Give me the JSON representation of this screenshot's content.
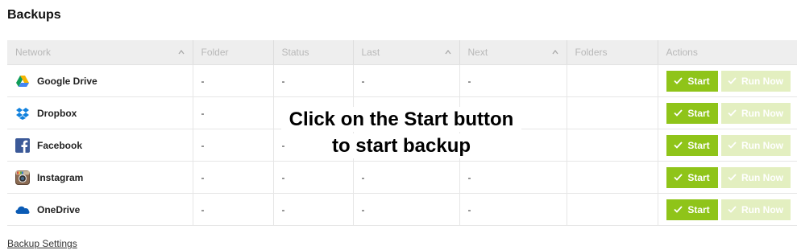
{
  "page": {
    "title": "Backups"
  },
  "table": {
    "headers": [
      "Network",
      "Folder",
      "Status",
      "Last",
      "Next",
      "Folders",
      "Actions"
    ],
    "rows": [
      {
        "network": "Google Drive",
        "icon": "google-drive-icon",
        "folder": "-",
        "status": "-",
        "last": "-",
        "next": "-",
        "folders": ""
      },
      {
        "network": "Dropbox",
        "icon": "dropbox-icon",
        "folder": "-",
        "status": "",
        "last": "",
        "next": "",
        "folders": ""
      },
      {
        "network": "Facebook",
        "icon": "facebook-icon",
        "folder": "-",
        "status": "-",
        "last": "",
        "next": "",
        "folders": ""
      },
      {
        "network": "Instagram",
        "icon": "instagram-icon",
        "folder": "-",
        "status": "-",
        "last": "-",
        "next": "-",
        "folders": ""
      },
      {
        "network": "OneDrive",
        "icon": "onedrive-icon",
        "folder": "-",
        "status": "-",
        "last": "-",
        "next": "-",
        "folders": ""
      }
    ]
  },
  "buttons": {
    "start": "Start",
    "run_now": "Run Now"
  },
  "overlay": {
    "line1": "Click on the Start button",
    "line2": "to start backup"
  },
  "footer": {
    "settings_link": "Backup Settings"
  },
  "colors": {
    "start_green": "#8fc419",
    "run_now_disabled": "#e3efc0",
    "header_bg": "#eeeeee"
  }
}
